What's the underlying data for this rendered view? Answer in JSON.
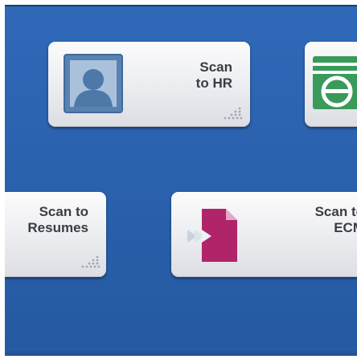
{
  "screen": {
    "tiles": [
      {
        "label": "Scan\nto HR",
        "icon": "person-photo-icon",
        "accent": "#4e78a8"
      },
      {
        "label": "",
        "icon": "ecm-logo-icon",
        "accent": "#3a9a5a"
      },
      {
        "label": "Scan to\nResumes",
        "icon": "dot-grid-icon"
      },
      {
        "label": "Scan to\nECM",
        "icon": "document-arrow-icon",
        "accent": "#b0246a"
      }
    ]
  },
  "colors": {
    "background": "#2a61ad",
    "tile_text": "#3a3c42"
  }
}
